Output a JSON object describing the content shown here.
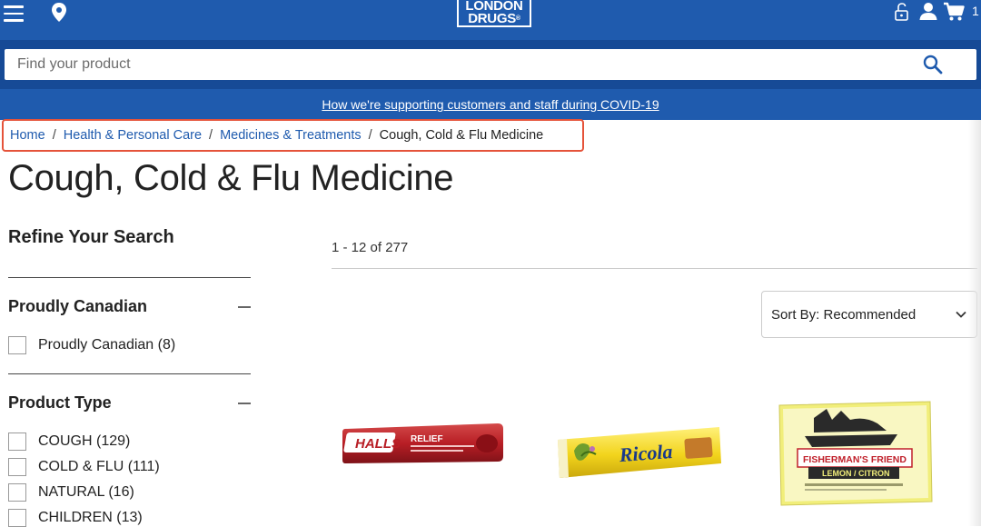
{
  "header": {
    "logo_line1": "LONDON",
    "logo_line2": "DRUGS",
    "cart_count": "1"
  },
  "search": {
    "placeholder": "Find your product"
  },
  "notice": {
    "covid_link": "How we're supporting customers and staff during COVID-19"
  },
  "breadcrumb": {
    "home": "Home",
    "level1": "Health & Personal Care",
    "level2": "Medicines & Treatments",
    "current": "Cough, Cold & Flu Medicine",
    "separator": "/"
  },
  "page": {
    "title": "Cough, Cold & Flu Medicine"
  },
  "filters": {
    "title": "Refine Your Search",
    "sections": [
      {
        "title": "Proudly Canadian",
        "options": [
          {
            "label": "Proudly Canadian (8)"
          }
        ]
      },
      {
        "title": "Product Type",
        "options": [
          {
            "label": "COUGH (129)"
          },
          {
            "label": "COLD & FLU (111)"
          },
          {
            "label": "NATURAL (16)"
          },
          {
            "label": "CHILDREN (13)"
          }
        ]
      }
    ]
  },
  "results": {
    "count_text": "1 - 12 of 277",
    "sort_label": "Sort By: Recommended"
  },
  "products": [
    {
      "brand_text": "HALLS",
      "sub_text": "RELIEF"
    },
    {
      "brand_text": "Ricola"
    },
    {
      "brand_text": "FISHERMAN'S FRIEND",
      "flavour": "LEMON / CITRON"
    }
  ],
  "colors": {
    "brand_blue": "#1f5bae",
    "dark_blue": "#164a96",
    "highlight": "#e5533a"
  }
}
